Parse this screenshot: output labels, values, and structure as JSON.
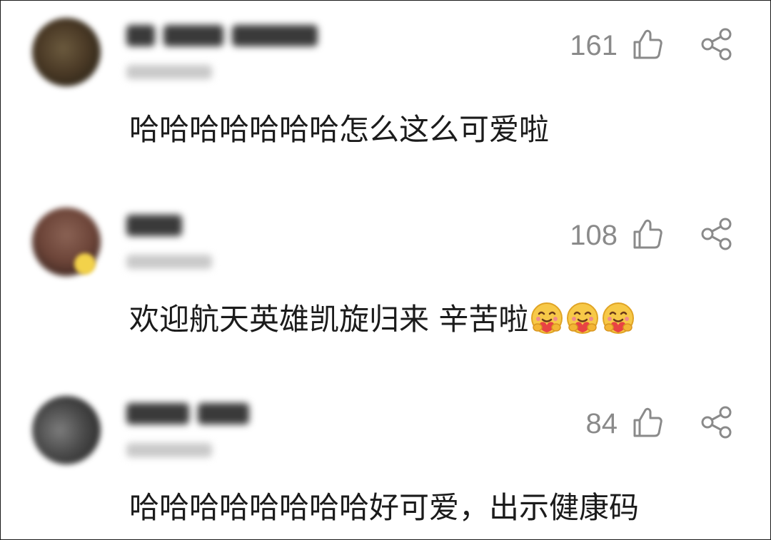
{
  "comments": [
    {
      "likes": "161",
      "text": "哈哈哈哈哈哈哈怎么这么可爱啦",
      "emojis": []
    },
    {
      "likes": "108",
      "text": "欢迎航天英雄凯旋归来 辛苦啦",
      "emojis": [
        "hugging-face-emoji",
        "hugging-face-emoji",
        "hugging-face-emoji"
      ]
    },
    {
      "likes": "84",
      "text": "哈哈哈哈哈哈哈哈好可爱，出示健康码",
      "emojis": []
    }
  ],
  "icons": {
    "like": "thumbs-up-icon",
    "share": "share-icon"
  },
  "colors": {
    "count_gray": "#8a8a8a",
    "text": "#1b1b1b",
    "background": "#ffffff"
  }
}
